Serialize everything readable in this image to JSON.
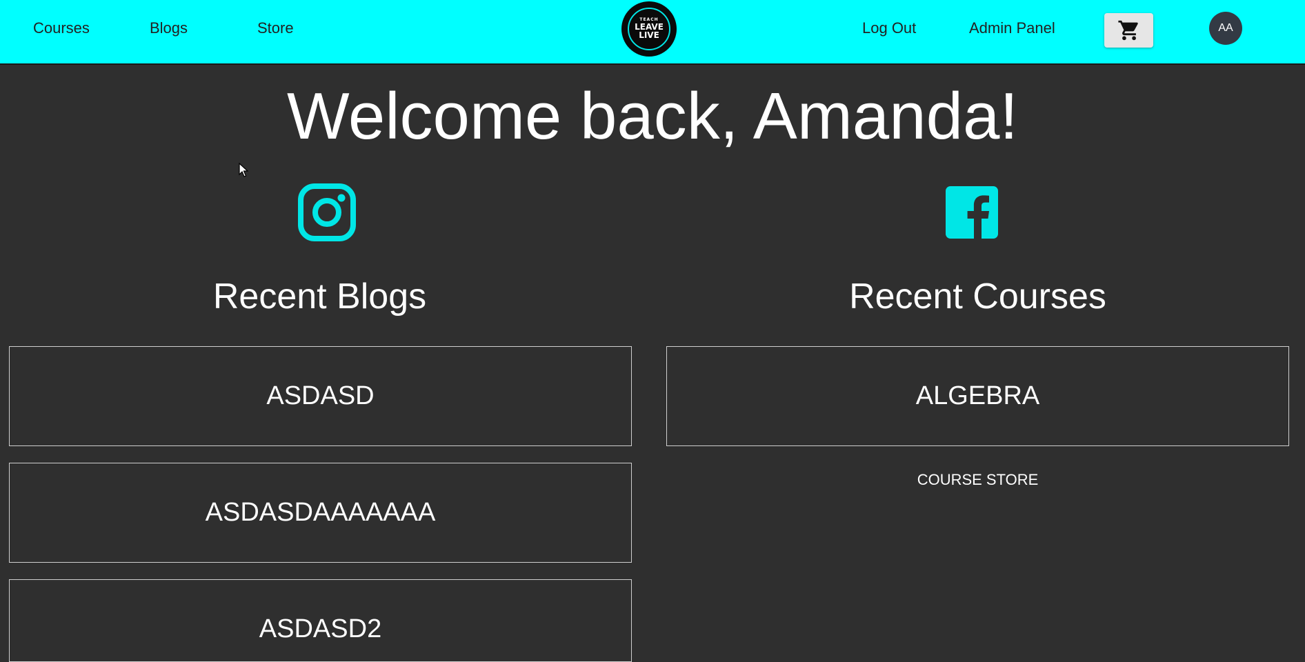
{
  "nav": {
    "links": [
      "Courses",
      "Blogs",
      "Store"
    ],
    "right_links": [
      "Log Out",
      "Admin Panel"
    ],
    "logo": {
      "small": "TEACH",
      "line1": "LEAVE",
      "line2": "LIVE"
    },
    "cart_icon": "shopping-cart-icon",
    "avatar_initials": "AA"
  },
  "main": {
    "welcome": "Welcome back, Amanda!",
    "social": {
      "left_icon": "instagram-icon",
      "right_icon": "facebook-icon"
    },
    "blogs": {
      "title": "Recent Blogs",
      "items": [
        "ASDASD",
        "ASDASDAAAAAAA",
        "ASDASD2"
      ]
    },
    "courses": {
      "title": "Recent Courses",
      "items": [
        "ALGEBRA"
      ],
      "store_link": "COURSE STORE"
    }
  },
  "colors": {
    "accent": "#00ffff",
    "background": "#2f2f2f",
    "text": "#ffffff"
  }
}
